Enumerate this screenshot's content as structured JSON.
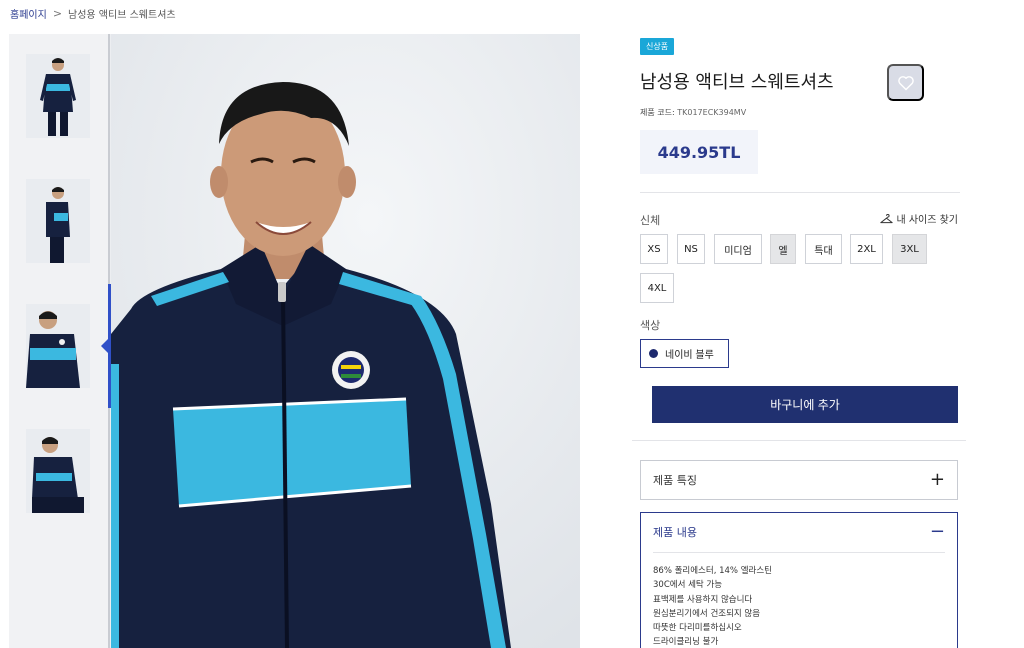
{
  "breadcrumb": {
    "home": "홈페이지",
    "separator": ">",
    "current": "남성용 액티브 스웨트셔츠"
  },
  "product": {
    "badge": "신상품",
    "title": "남성용 액티브 스웨트셔츠",
    "code_label": "제품 코드:",
    "code_value": "TK017ECK394MV",
    "price": "449.95TL",
    "favorite_icon": "heart-icon"
  },
  "size": {
    "label": "신체",
    "finder_icon": "hanger-icon",
    "finder_label": "내 사이즈 찾기",
    "options": [
      {
        "label": "XS",
        "available": true
      },
      {
        "label": "NS",
        "available": true
      },
      {
        "label": "미디엄",
        "available": true
      },
      {
        "label": "엘",
        "available": false
      },
      {
        "label": "특대",
        "available": true
      },
      {
        "label": "2XL",
        "available": true
      },
      {
        "label": "3XL",
        "available": false
      },
      {
        "label": "4XL",
        "available": true
      }
    ]
  },
  "color": {
    "label": "색상",
    "selected": "네이비 블루",
    "swatch": "#1e2a6e"
  },
  "cart_button": "바구니에 추가",
  "accordions": {
    "features": {
      "title": "제품 특징",
      "toggle": "+"
    },
    "content": {
      "title": "제품 내용",
      "toggle": "−",
      "lines": [
        "86% 폴리에스터, 14% 엘라스틴",
        "30C에서 세탁 가능",
        "표백제를 사용하지 않습니다",
        "원심분리기에서 건조되지 않음",
        "따뜻한 다리미를하십시오",
        "드라이클리닝 불가"
      ]
    }
  },
  "colors": {
    "brand_navy": "#203070",
    "badge_cyan": "#1aa7d8",
    "price_text": "#2b3a8c",
    "jacket_navy": "#16213f",
    "jacket_stripe": "#3bb8e0"
  }
}
